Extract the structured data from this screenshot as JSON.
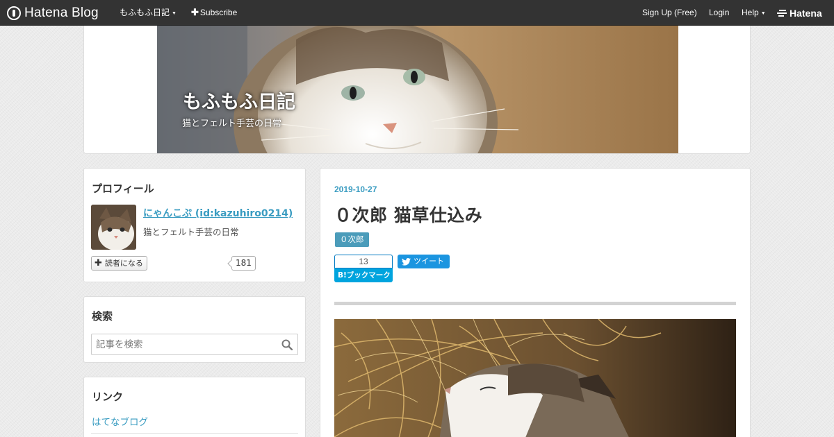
{
  "topbar": {
    "logo": "Hatena Blog",
    "blog_menu": "もふもふ日記",
    "subscribe": "Subscribe",
    "signup": "Sign Up (Free)",
    "login": "Login",
    "help": "Help",
    "hatena": "Hatena"
  },
  "header": {
    "title": "もふもふ日記",
    "description": "猫とフェルト手芸の日常"
  },
  "sidebar": {
    "profile": {
      "heading": "プロフィール",
      "user": "にゃんこぷ (id:kazuhiro0214)",
      "description": "猫とフェルト手芸の日常",
      "follow_label": "読者になる",
      "follower_count": "181"
    },
    "search": {
      "heading": "検索",
      "placeholder": "記事を検索"
    },
    "links": {
      "heading": "リンク",
      "items": [
        "はてなブログ"
      ]
    }
  },
  "entry": {
    "date": "2019-10-27",
    "title": "０次郎 猫草仕込み",
    "category": "０次郎",
    "bookmark_count": "13",
    "bookmark_label": "B!ブックマーク",
    "tweet_label": "ツイート"
  },
  "colors": {
    "topbar_bg": "#333333",
    "link": "#3a9cc1",
    "category_bg": "#4b9cba",
    "bookmark_blue": "#00a4de",
    "twitter_blue": "#1b95e0"
  }
}
